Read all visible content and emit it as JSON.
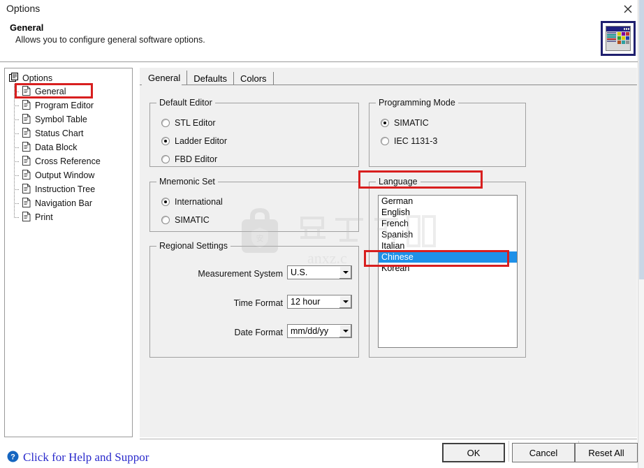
{
  "window": {
    "title": "Options",
    "close_icon": "close-icon",
    "header_title": "General",
    "header_subtitle": "Allows you to configure general software options.",
    "preview_icon": "options-dialog-preview-icon"
  },
  "sidebar": {
    "root_label": "Options",
    "root_icon": "options-tree-icon",
    "items": [
      {
        "label": "General",
        "icon": "document-icon",
        "selected": true
      },
      {
        "label": "Program Editor",
        "icon": "document-icon",
        "selected": false
      },
      {
        "label": "Symbol Table",
        "icon": "document-icon",
        "selected": false
      },
      {
        "label": "Status Chart",
        "icon": "document-icon",
        "selected": false
      },
      {
        "label": "Data Block",
        "icon": "document-icon",
        "selected": false
      },
      {
        "label": "Cross Reference",
        "icon": "document-icon",
        "selected": false
      },
      {
        "label": "Output Window",
        "icon": "document-icon",
        "selected": false
      },
      {
        "label": "Instruction Tree",
        "icon": "document-icon",
        "selected": false
      },
      {
        "label": "Navigation Bar",
        "icon": "document-icon",
        "selected": false
      },
      {
        "label": "Print",
        "icon": "document-icon",
        "selected": false
      }
    ]
  },
  "tabs": [
    {
      "label": "General",
      "active": true
    },
    {
      "label": "Defaults",
      "active": false
    },
    {
      "label": "Colors",
      "active": false
    }
  ],
  "groups": {
    "default_editor": {
      "title": "Default Editor",
      "options": [
        {
          "label": "STL Editor",
          "checked": false
        },
        {
          "label": "Ladder Editor",
          "checked": true
        },
        {
          "label": "FBD Editor",
          "checked": false
        }
      ]
    },
    "programming_mode": {
      "title": "Programming Mode",
      "options": [
        {
          "label": "SIMATIC",
          "checked": true
        },
        {
          "label": "IEC 1131-3",
          "checked": false
        }
      ]
    },
    "mnemonic_set": {
      "title": "Mnemonic Set",
      "options": [
        {
          "label": "International",
          "checked": true
        },
        {
          "label": "SIMATIC",
          "checked": false
        }
      ]
    },
    "language": {
      "title": "Language",
      "items": [
        {
          "label": "German",
          "selected": false
        },
        {
          "label": "English",
          "selected": false
        },
        {
          "label": "French",
          "selected": false
        },
        {
          "label": "Spanish",
          "selected": false
        },
        {
          "label": "Italian",
          "selected": false
        },
        {
          "label": "Chinese",
          "selected": true
        },
        {
          "label": "Korean",
          "selected": false
        }
      ]
    },
    "regional_settings": {
      "title": "Regional Settings",
      "fields": [
        {
          "label": "Measurement System",
          "value": "U.S."
        },
        {
          "label": "Time Format",
          "value": "12 hour"
        },
        {
          "label": "Date Format",
          "value": "mm/dd/yy"
        }
      ]
    }
  },
  "footer": {
    "help_icon": "help-question-icon",
    "help_text": "Click for Help and Suppor",
    "buttons": [
      {
        "label": "OK",
        "default": true
      },
      {
        "label": "Cancel",
        "default": false
      },
      {
        "label": "Reset All",
        "default": false
      }
    ]
  },
  "watermark": {
    "logo_char": "安",
    "text_cn": "安下载",
    "text_en": "anxz.c"
  },
  "colors": {
    "selection_blue": "#1e90e8",
    "annotation_red": "#d81f1f",
    "link_blue": "#2b2bcc",
    "icon_navy": "#1f1f6e"
  }
}
